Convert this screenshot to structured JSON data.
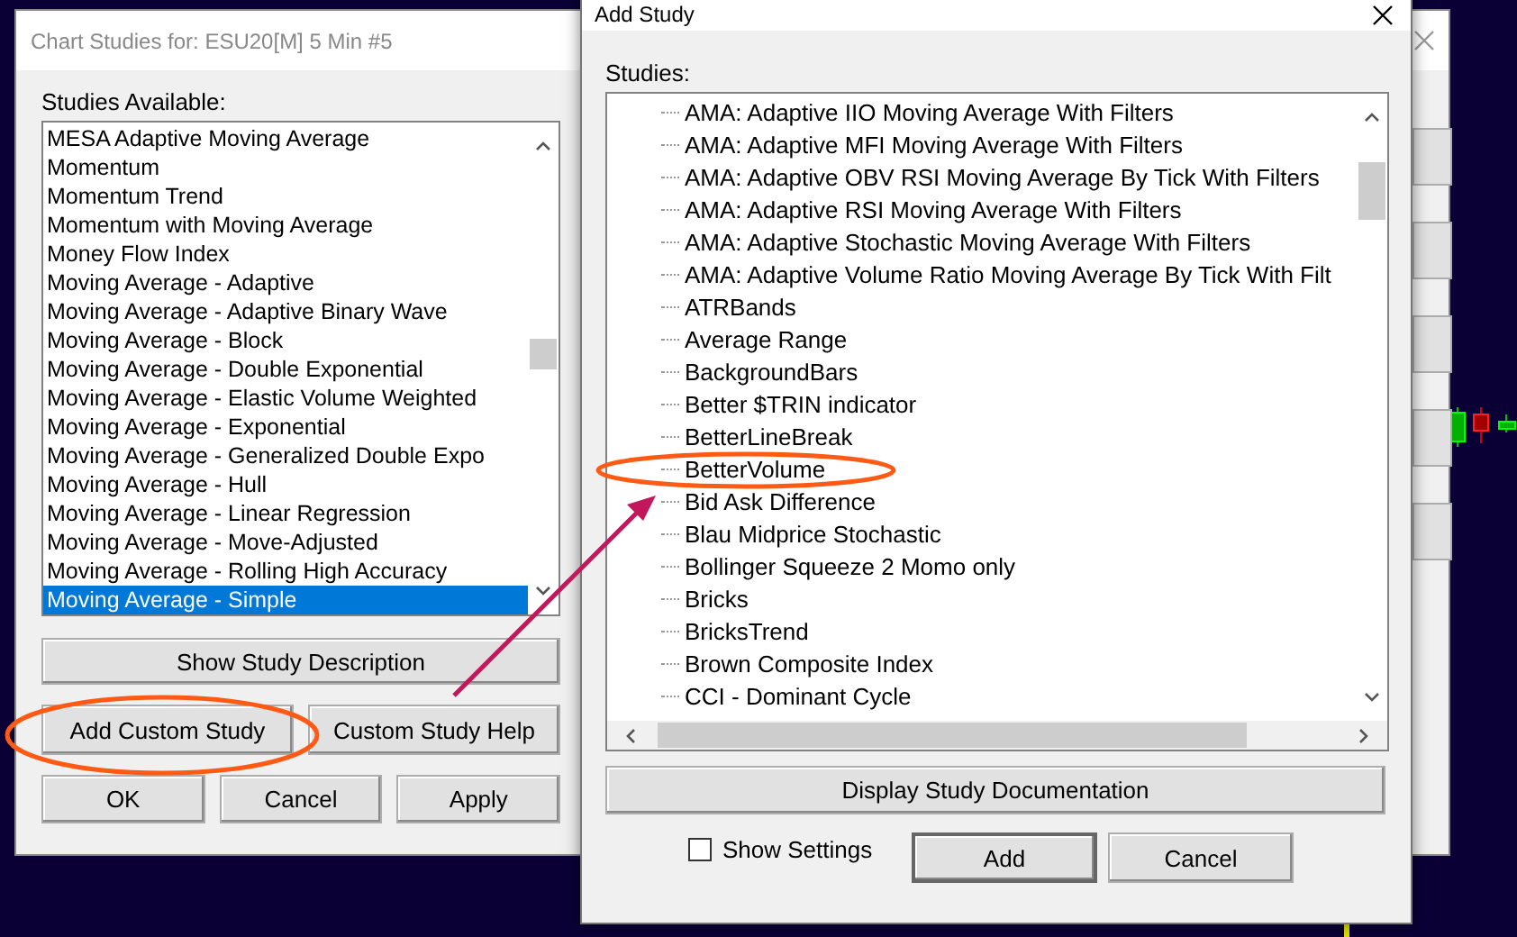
{
  "back_dialog": {
    "title": "Chart Studies for: ESU20[M]  5 Min   #5",
    "list_label": "Studies Available:",
    "studies": [
      {
        "label": "MESA Adaptive Moving Average",
        "selected": false
      },
      {
        "label": "Momentum",
        "selected": false
      },
      {
        "label": "Momentum Trend",
        "selected": false
      },
      {
        "label": "Momentum with Moving Average",
        "selected": false
      },
      {
        "label": "Money Flow Index",
        "selected": false
      },
      {
        "label": "Moving Average - Adaptive",
        "selected": false
      },
      {
        "label": "Moving Average - Adaptive Binary Wave",
        "selected": false
      },
      {
        "label": "Moving Average - Block",
        "selected": false
      },
      {
        "label": "Moving Average - Double Exponential",
        "selected": false
      },
      {
        "label": "Moving Average - Elastic Volume Weighted",
        "selected": false
      },
      {
        "label": "Moving Average - Exponential",
        "selected": false
      },
      {
        "label": "Moving Average - Generalized Double Expo",
        "selected": false
      },
      {
        "label": "Moving Average - Hull",
        "selected": false
      },
      {
        "label": "Moving Average - Linear Regression",
        "selected": false
      },
      {
        "label": "Moving Average - Move-Adjusted",
        "selected": false
      },
      {
        "label": "Moving Average - Rolling High Accuracy",
        "selected": false
      },
      {
        "label": "Moving Average - Simple",
        "selected": true
      }
    ],
    "description_button": "Show Study Description",
    "custom_buttons": [
      "Add Custom Study",
      "Custom Study Help"
    ],
    "buttons": [
      "OK",
      "Cancel",
      "Apply"
    ]
  },
  "add_study_dialog": {
    "title": "Add Study",
    "list_label": "Studies:",
    "studies": [
      {
        "label": "AMA: Adaptive IIO Moving Average With Filters",
        "selected": false
      },
      {
        "label": "AMA: Adaptive MFI Moving Average With Filters",
        "selected": false
      },
      {
        "label": "AMA: Adaptive OBV RSI Moving Average By Tick With Filters",
        "selected": false
      },
      {
        "label": "AMA: Adaptive RSI Moving Average With Filters",
        "selected": false
      },
      {
        "label": "AMA: Adaptive Stochastic Moving Average With Filters",
        "selected": false
      },
      {
        "label": "AMA: Adaptive Volume Ratio Moving Average By Tick With Filt",
        "selected": false
      },
      {
        "label": "ATRBands",
        "selected": false
      },
      {
        "label": "Average Range",
        "selected": false
      },
      {
        "label": "BackgroundBars",
        "selected": false
      },
      {
        "label": "Better $TRIN indicator",
        "selected": false
      },
      {
        "label": "BetterLineBreak",
        "selected": false
      },
      {
        "label": "BetterVolume",
        "selected": false
      },
      {
        "label": "Bid Ask Difference",
        "selected": false
      },
      {
        "label": "Blau Midprice Stochastic",
        "selected": false
      },
      {
        "label": "Bollinger Squeeze 2 Momo only",
        "selected": false
      },
      {
        "label": "Bricks",
        "selected": false
      },
      {
        "label": "BricksTrend",
        "selected": false
      },
      {
        "label": "Brown Composite Index",
        "selected": false
      },
      {
        "label": "CCI - Dominant Cycle",
        "selected": false
      }
    ],
    "documentation_button": "Display Study Documentation",
    "show_settings": {
      "label": "Show Settings",
      "checked": false
    },
    "buttons": [
      "Add",
      "Cancel"
    ]
  }
}
